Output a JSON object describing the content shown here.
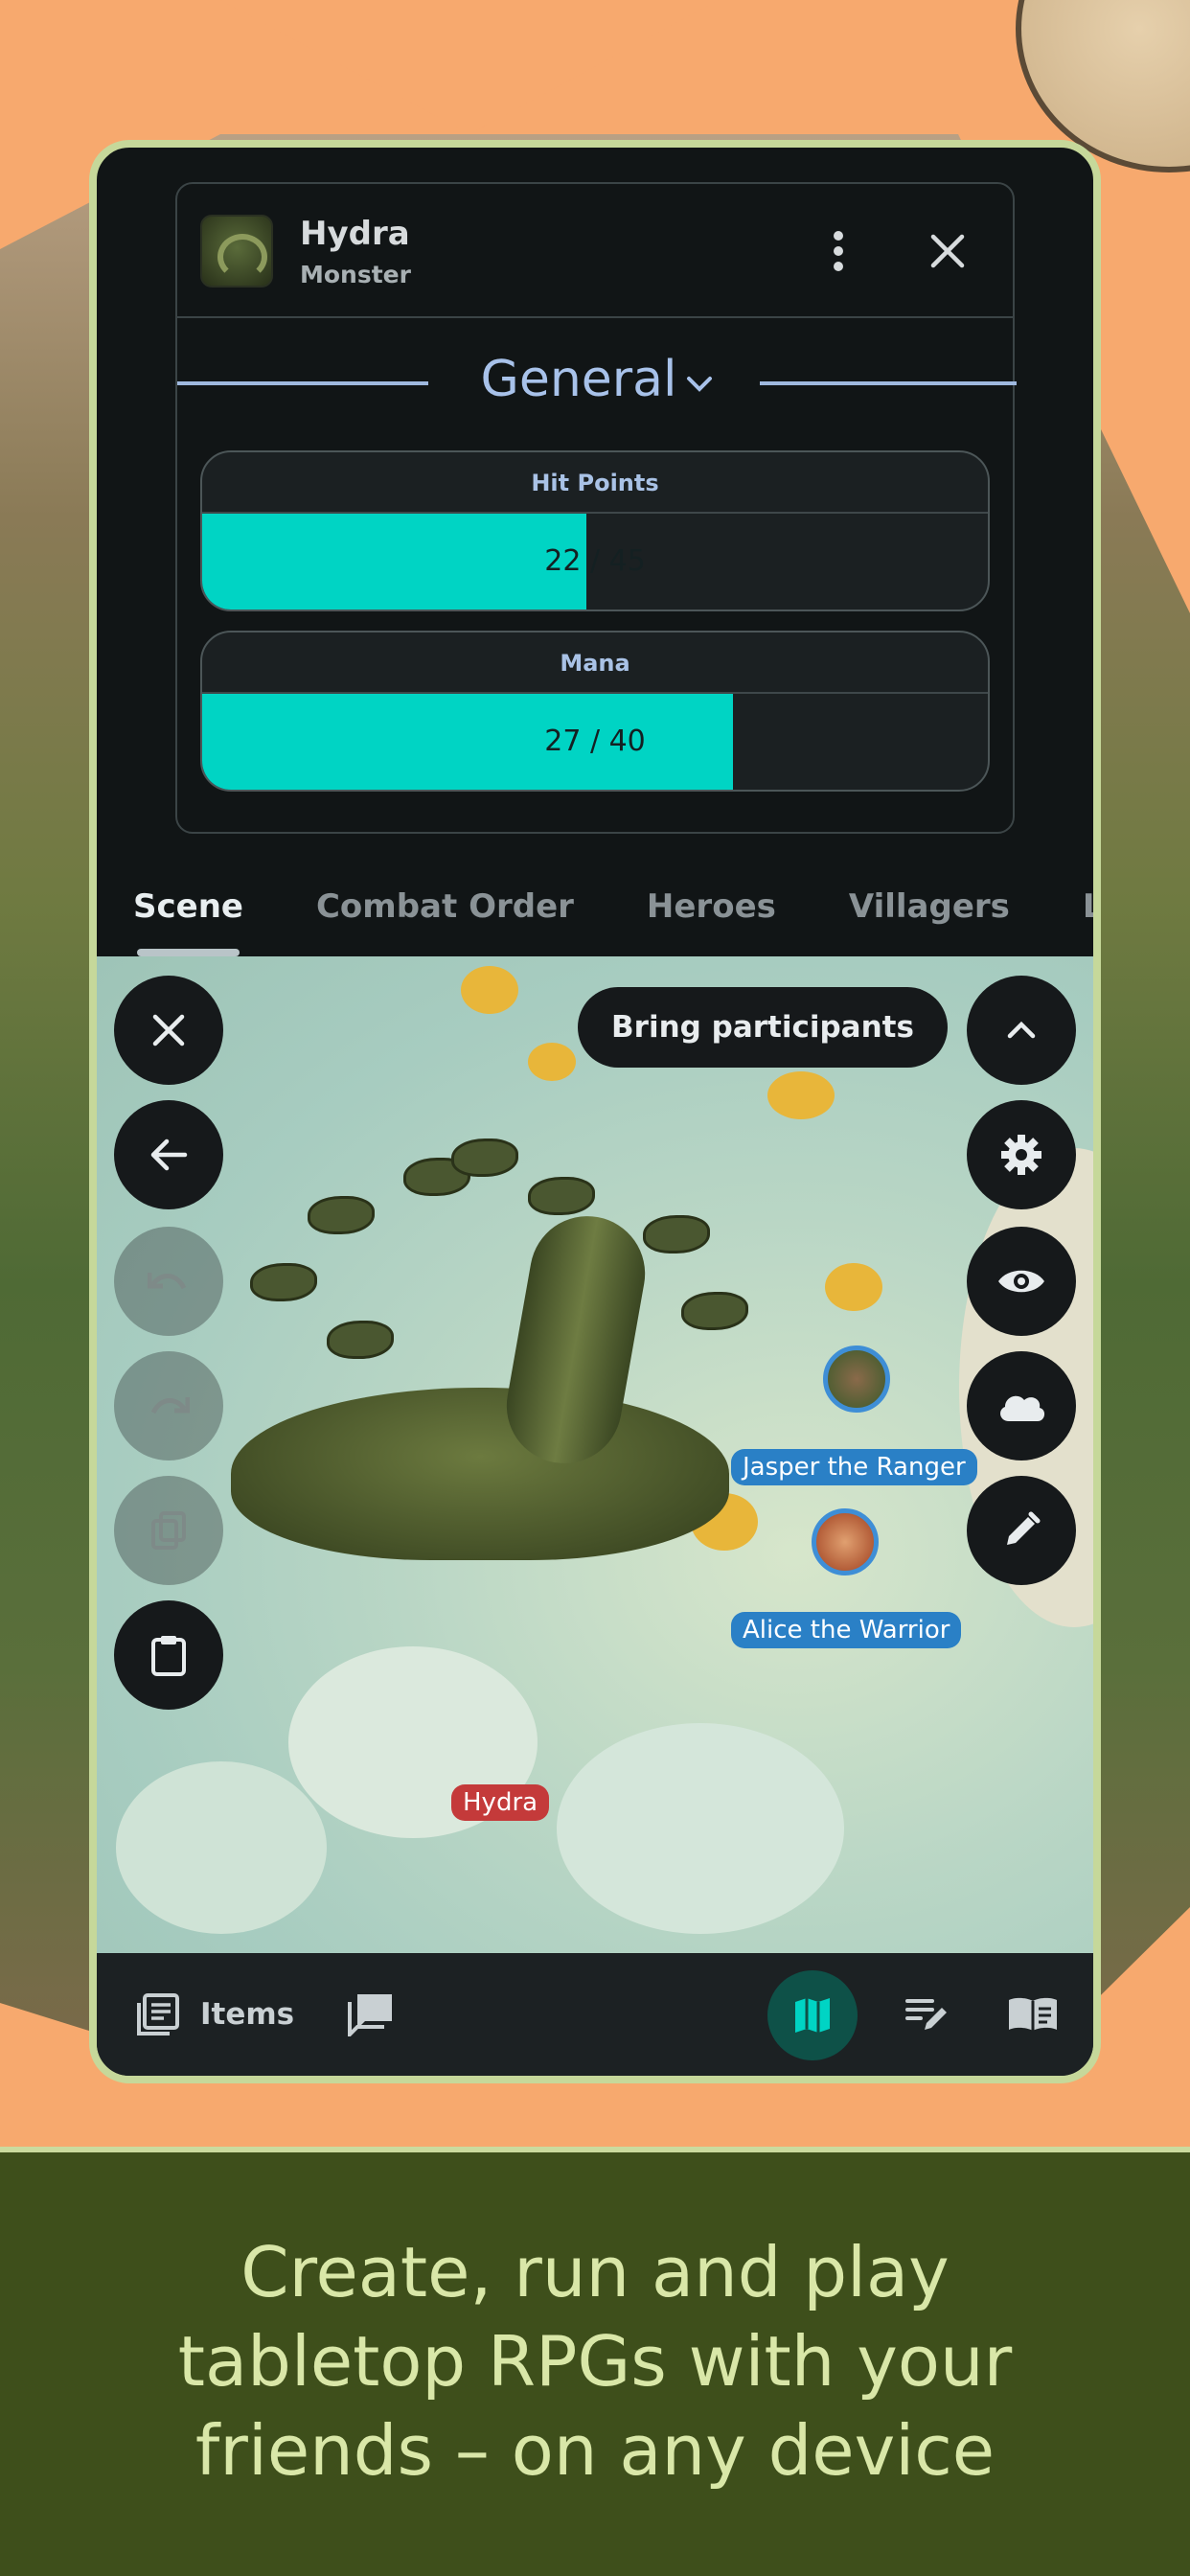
{
  "card": {
    "name": "Hydra",
    "subtitle": "Monster",
    "section": "General",
    "stats": [
      {
        "label": "Hit Points",
        "value_text": "22 / 45",
        "fill_fraction": 0.489
      },
      {
        "label": "Mana",
        "value_text": "27 / 40",
        "fill_fraction": 0.675
      }
    ]
  },
  "tabs": [
    "Scene",
    "Combat Order",
    "Heroes",
    "Villagers",
    "Loca"
  ],
  "map": {
    "bring_participants": "Bring participants",
    "tokens": {
      "hydra": "Hydra",
      "jasper": "Jasper the Ranger",
      "alice": "Alice the Warrior"
    }
  },
  "bottom_nav": {
    "items_label": "Items"
  },
  "tagline": [
    "Create, run and play",
    "tabletop RPGs with your",
    "friends – on any device"
  ],
  "colors": {
    "accent": "#00d4c4",
    "background": "#f7a96e",
    "footer": "#3e4f1b",
    "tagline": "#d9e7a8"
  }
}
